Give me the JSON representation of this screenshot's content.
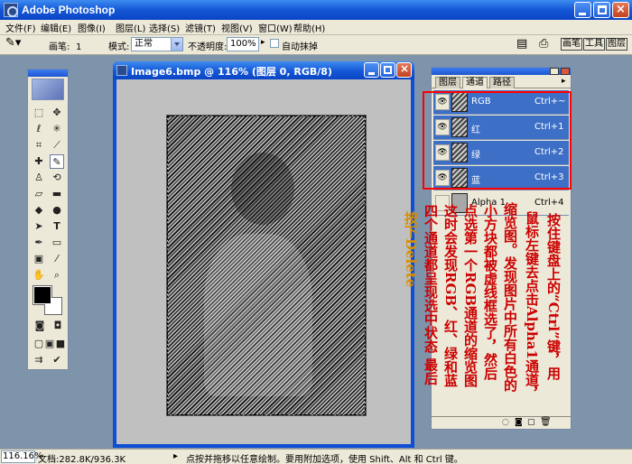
{
  "app": {
    "title": "Adobe Photoshop",
    "colors": {
      "titlebar": "#1457d6",
      "chrome": "#ece9d8",
      "desktop": "#7e94ab",
      "selection": "#3e6fc6",
      "annotation_red": "#cc0000",
      "annotation_orange": "#d98e00"
    }
  },
  "menu": {
    "items": [
      "文件(F)",
      "编辑(E)",
      "图像(I)",
      "图层(L)",
      "选择(S)",
      "滤镜(T)",
      "视图(V)",
      "窗口(W)",
      "帮助(H)"
    ]
  },
  "options": {
    "brush_label": "画笔:",
    "brush_size": "1",
    "mode_label": "模式:",
    "mode_value": "正常",
    "opacity_label": "不透明度:",
    "opacity_value": "100%",
    "autoerase_label": "自动抹掉",
    "palette_tabs": [
      "画笔",
      "工具",
      "图层"
    ]
  },
  "toolbox": {
    "tools": [
      "marquee-icon",
      "move-icon",
      "lasso-icon",
      "magic-wand-icon",
      "crop-icon",
      "slice-icon",
      "healing-icon",
      "pencil-icon",
      "stamp-icon",
      "history-brush-icon",
      "eraser-icon",
      "gradient-icon",
      "blur-icon",
      "dodge-icon",
      "path-select-icon",
      "type-icon",
      "pen-icon",
      "shape-icon",
      "notes-icon",
      "eyedropper-icon",
      "hand-icon",
      "zoom-icon"
    ]
  },
  "document": {
    "title": "Image6.bmp @ 116% (图层 0, RGB/8)"
  },
  "channels_panel": {
    "tabs": [
      "图层",
      "通道",
      "路径"
    ],
    "channels": [
      {
        "name": "RGB",
        "shortcut": "Ctrl+~",
        "visible": true,
        "selected": true
      },
      {
        "name": "红",
        "shortcut": "Ctrl+1",
        "visible": true,
        "selected": true
      },
      {
        "name": "绿",
        "shortcut": "Ctrl+2",
        "visible": true,
        "selected": true
      },
      {
        "name": "蓝",
        "shortcut": "Ctrl+3",
        "visible": true,
        "selected": true
      },
      {
        "name": "Alpha 1",
        "shortcut": "Ctrl+4",
        "visible": false,
        "selected": false
      }
    ]
  },
  "annotation": {
    "columns_red": [
      "按住键盘上的“Ctrl”键，用",
      "鼠标左键去点击Alpha1通道，",
      "缩览图。发现图片中所有白色的",
      "小方块都被虚线框选了，然后",
      "点选第一个RGB通道的缩览图",
      "这时会发现RGB、红、绿和蓝",
      "四个通道都呈现选中状态 最后"
    ],
    "column_orange": "按下Delete"
  },
  "status": {
    "zoom": "116.16%",
    "doc_size": "文档:282.8K/936.3K",
    "tip": "点按并拖移以任意绘制。要用附加选项，使用 Shift、Alt 和 Ctrl 键。"
  }
}
